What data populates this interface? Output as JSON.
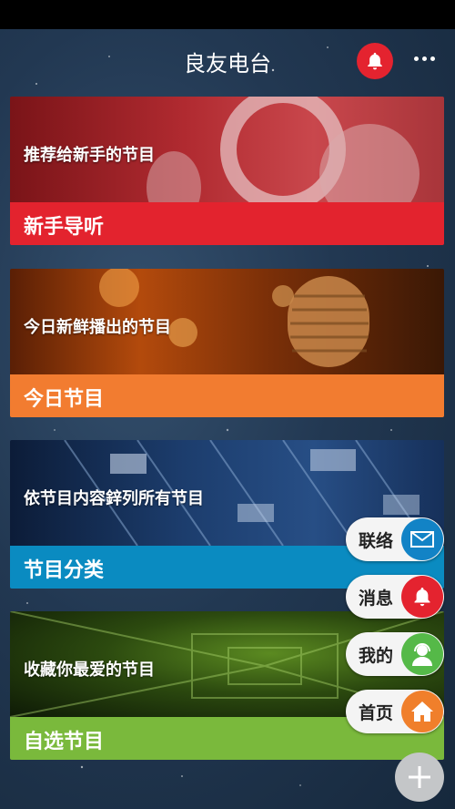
{
  "header": {
    "title": "良友电台"
  },
  "cards": [
    {
      "subtitle": "推荐给新手的节目",
      "label": "新手导听"
    },
    {
      "subtitle": "今日新鲜播出的节目",
      "label": "今日节目"
    },
    {
      "subtitle": "依节目内容鋅列所有节目",
      "label": "节目分类"
    },
    {
      "subtitle": "收藏你最爱的节目",
      "label": "自选节目"
    }
  ],
  "fab_menu": [
    {
      "label": "联络",
      "icon": "envelope-icon",
      "color": "#1283c6"
    },
    {
      "label": "消息",
      "icon": "bell-icon",
      "color": "#e4232f"
    },
    {
      "label": "我的",
      "icon": "user-headset-icon",
      "color": "#55b948"
    },
    {
      "label": "首页",
      "icon": "home-icon",
      "color": "#f07f2b"
    }
  ],
  "colors": {
    "red": "#e3232e",
    "orange": "#f27c30",
    "blue": "#0a8bc1",
    "green": "#7ab93c"
  }
}
